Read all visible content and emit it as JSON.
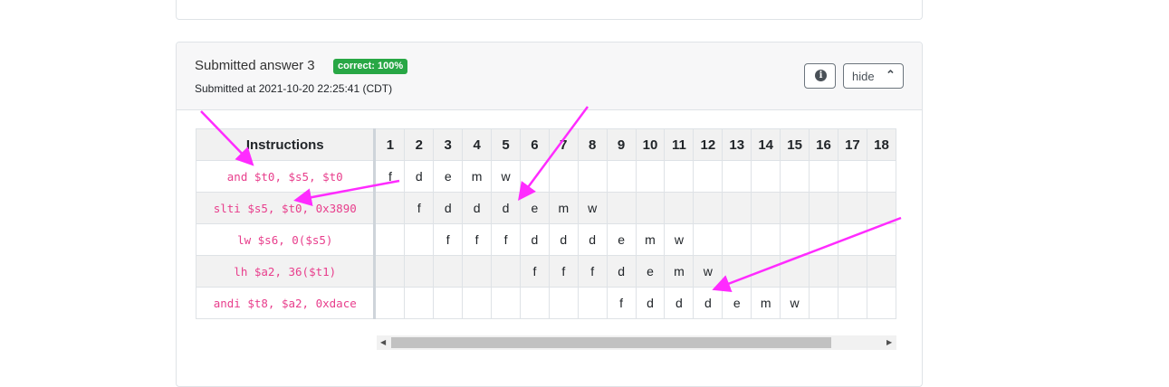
{
  "submission": {
    "title": "Submitted answer 3",
    "badge": "correct: 100%",
    "submitted_at": "Submitted at 2021-10-20 22:25:41 (CDT)",
    "info_icon": "i",
    "hide_label": "hide",
    "hide_icon": "chevron-up-icon"
  },
  "table": {
    "header_label": "Instructions",
    "columns": [
      "1",
      "2",
      "3",
      "4",
      "5",
      "6",
      "7",
      "8",
      "9",
      "10",
      "11",
      "12",
      "13",
      "14",
      "15",
      "16",
      "17",
      "18"
    ],
    "rows": [
      {
        "instruction": "and $t0, $s5, $t0",
        "stages": [
          "f",
          "d",
          "e",
          "m",
          "w",
          "",
          "",
          "",
          "",
          "",
          "",
          "",
          "",
          "",
          "",
          "",
          "",
          ""
        ]
      },
      {
        "instruction": "slti $s5, $t0, 0x3890",
        "stages": [
          "",
          "f",
          "d",
          "d",
          "d",
          "e",
          "m",
          "w",
          "",
          "",
          "",
          "",
          "",
          "",
          "",
          "",
          "",
          ""
        ]
      },
      {
        "instruction": "lw $s6, 0($s5)",
        "stages": [
          "",
          "",
          "f",
          "f",
          "f",
          "d",
          "d",
          "d",
          "e",
          "m",
          "w",
          "",
          "",
          "",
          "",
          "",
          "",
          ""
        ]
      },
      {
        "instruction": "lh $a2, 36($t1)",
        "stages": [
          "",
          "",
          "",
          "",
          "",
          "f",
          "f",
          "f",
          "d",
          "e",
          "m",
          "w",
          "",
          "",
          "",
          "",
          "",
          ""
        ]
      },
      {
        "instruction": "andi $t8, $a2, 0xdace",
        "stages": [
          "",
          "",
          "",
          "",
          "",
          "",
          "",
          "",
          "f",
          "d",
          "d",
          "d",
          "e",
          "m",
          "w",
          "",
          "",
          ""
        ]
      }
    ]
  },
  "colors": {
    "badge": "#28a745",
    "instruction_text": "#e83e8c",
    "annotation_arrows": "#ff2bff"
  }
}
